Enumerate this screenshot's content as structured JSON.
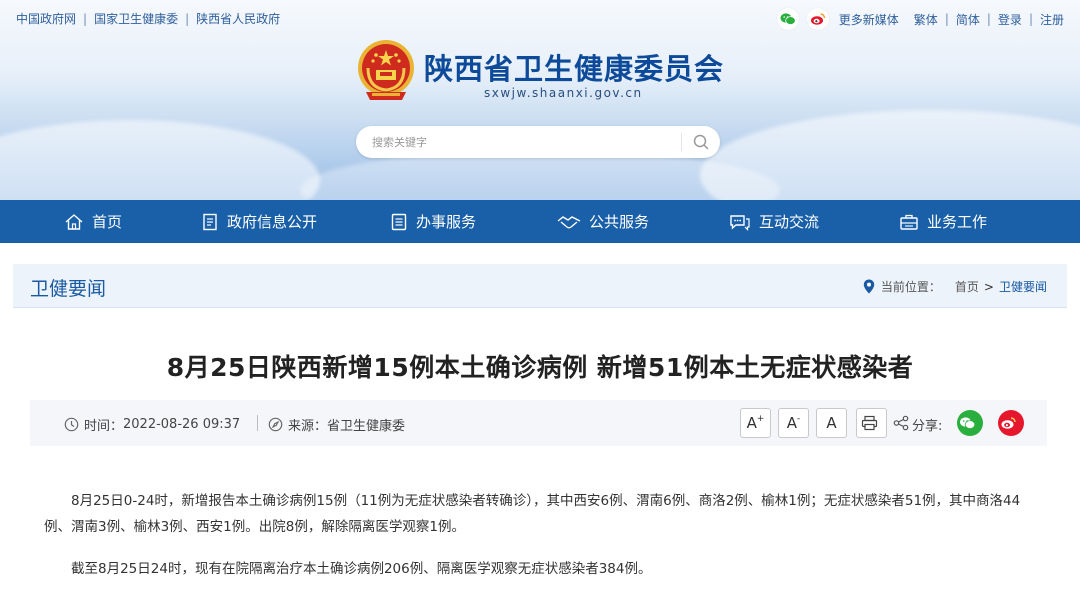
{
  "top_links": [
    "中国政府网",
    "国家卫生健康委",
    "陕西省人民政府"
  ],
  "top_right": {
    "more_media": "更多新媒体",
    "traditional": "繁体",
    "simplified": "简体",
    "login": "登录",
    "register": "注册"
  },
  "site": {
    "title": "陕西省卫生健康委员会",
    "domain": "sxwjw.shaanxi.gov.cn"
  },
  "search": {
    "placeholder": "搜索关键字"
  },
  "nav": [
    {
      "label": "首页",
      "icon": "home-icon"
    },
    {
      "label": "政府信息公开",
      "icon": "document-icon"
    },
    {
      "label": "办事服务",
      "icon": "list-icon"
    },
    {
      "label": "公共服务",
      "icon": "handshake-icon"
    },
    {
      "label": "互动交流",
      "icon": "chat-icon"
    },
    {
      "label": "业务工作",
      "icon": "briefcase-icon"
    }
  ],
  "section": {
    "title": "卫健要闻",
    "breadcrumb_label": "当前位置：",
    "breadcrumb_home": "首页",
    "breadcrumb_sep": ">",
    "breadcrumb_current": "卫健要闻"
  },
  "article": {
    "title": "8月25日陕西新增15例本土确诊病例 新增51例本土无症状感染者",
    "time_label": "时间：",
    "time_value": "2022-08-26 09:37",
    "source_label": "来源：",
    "source_value": "省卫生健康委",
    "font_controls": {
      "larger": "A",
      "larger_sup": "+",
      "smaller": "A",
      "smaller_sup": "-",
      "normal": "A"
    },
    "share_label": "分享:",
    "paragraphs": [
      "8月25日0-24时，新增报告本土确诊病例15例（11例为无症状感染者转确诊），其中西安6例、渭南6例、商洛2例、榆林1例；无症状感染者51例，其中商洛44例、渭南3例、榆林3例、西安1例。出院8例，解除隔离医学观察1例。",
      "截至8月25日24时，现有在院隔离治疗本土确诊病例206例、隔离医学观察无症状感染者384例。"
    ]
  },
  "colors": {
    "nav_bg": "#1960a9",
    "title_blue": "#0d4a9a",
    "wechat_green": "#2aae3e",
    "weibo_red": "#e6162d"
  }
}
